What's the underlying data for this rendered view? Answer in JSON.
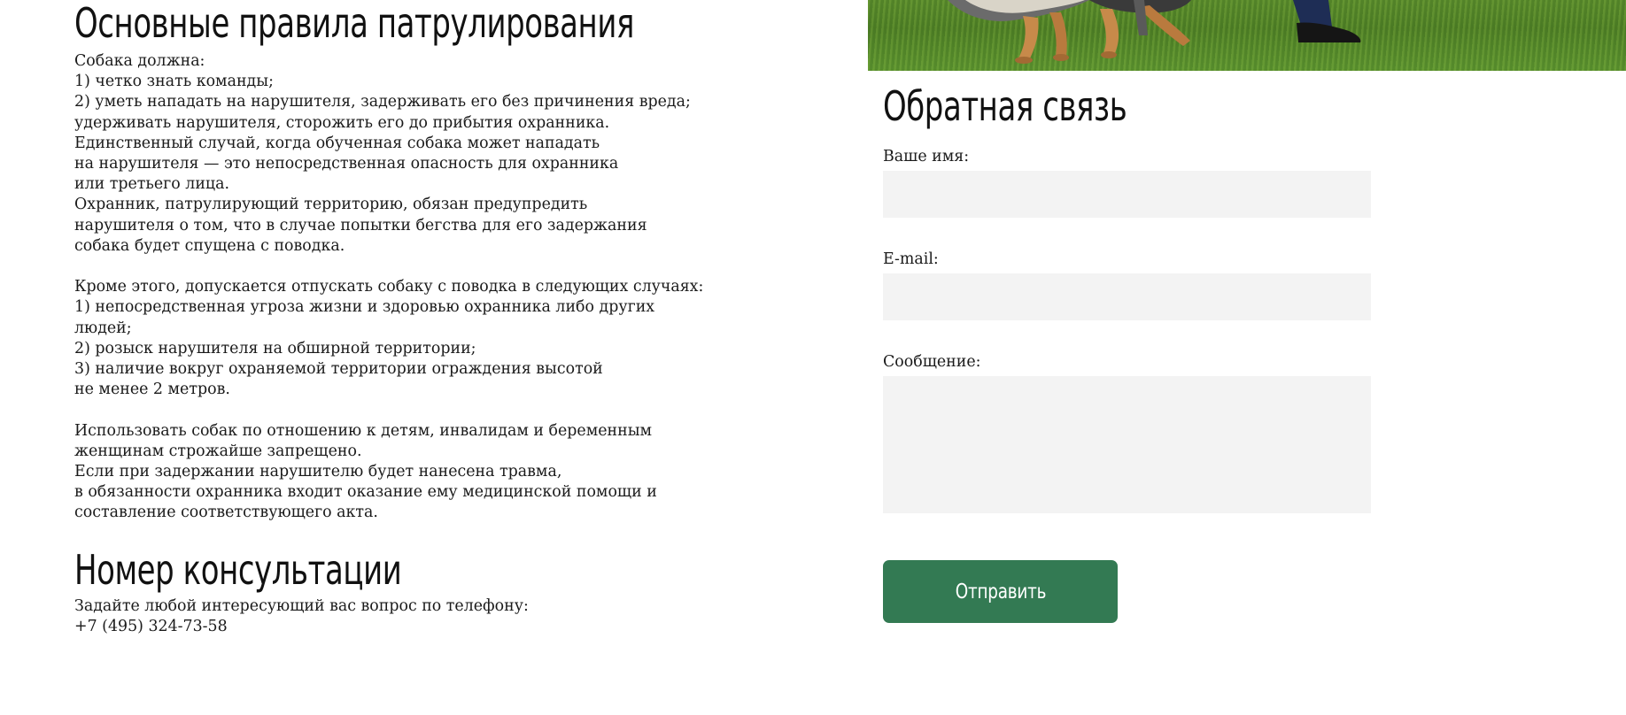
{
  "rules": {
    "title": "Основные правила патрулирования",
    "text": "Собака должна:\n1) четко знать команды;\n2) уметь нападать на нарушителя, задерживать его без причинения вреда;\nудерживать нарушителя, сторожить его до прибытия охранника.\nЕдинственный случай, когда обученная собака может нападать\nна нарушителя — это непосредственная опасность для охранника\nили третьего лица.\nОхранник, патрулирующий территорию, обязан предупредить\nнарушителя о том, что в случае попытки бегства для его задержания\nсобака будет спущена с поводка.\n\nКроме этого, допускается отпускать собаку с поводка в следующих случаях:\n1) непосредственная угроза жизни и здоровью охранника либо других\nлюдей;\n2) розыск нарушителя на обширной территории;\n3) наличие вокруг охраняемой территории ограждения высотой\nне менее 2 метров.\n\nИспользовать собак по отношению к детям, инвалидам и беременным\nженщинам строжайше запрещено.\nЕсли при задержании нарушителю будет нанесена травма,\nв обязанности охранника входит оказание ему медицинской помощи и\nсоставление соответствующего акта."
  },
  "consultation": {
    "title": "Номер консультации",
    "text": "Задайте любой интересующий вас вопрос по телефону:\n+7 (495) 324-73-58"
  },
  "feedback": {
    "title": "Обратная связь",
    "name_label": "Ваше имя:",
    "name_value": "",
    "email_label": "E-mail:",
    "email_value": "",
    "message_label": "Сообщение:",
    "message_value": "",
    "submit_label": "Отправить"
  },
  "colors": {
    "button": "#337a53",
    "input_bg": "#f3f3f3"
  }
}
